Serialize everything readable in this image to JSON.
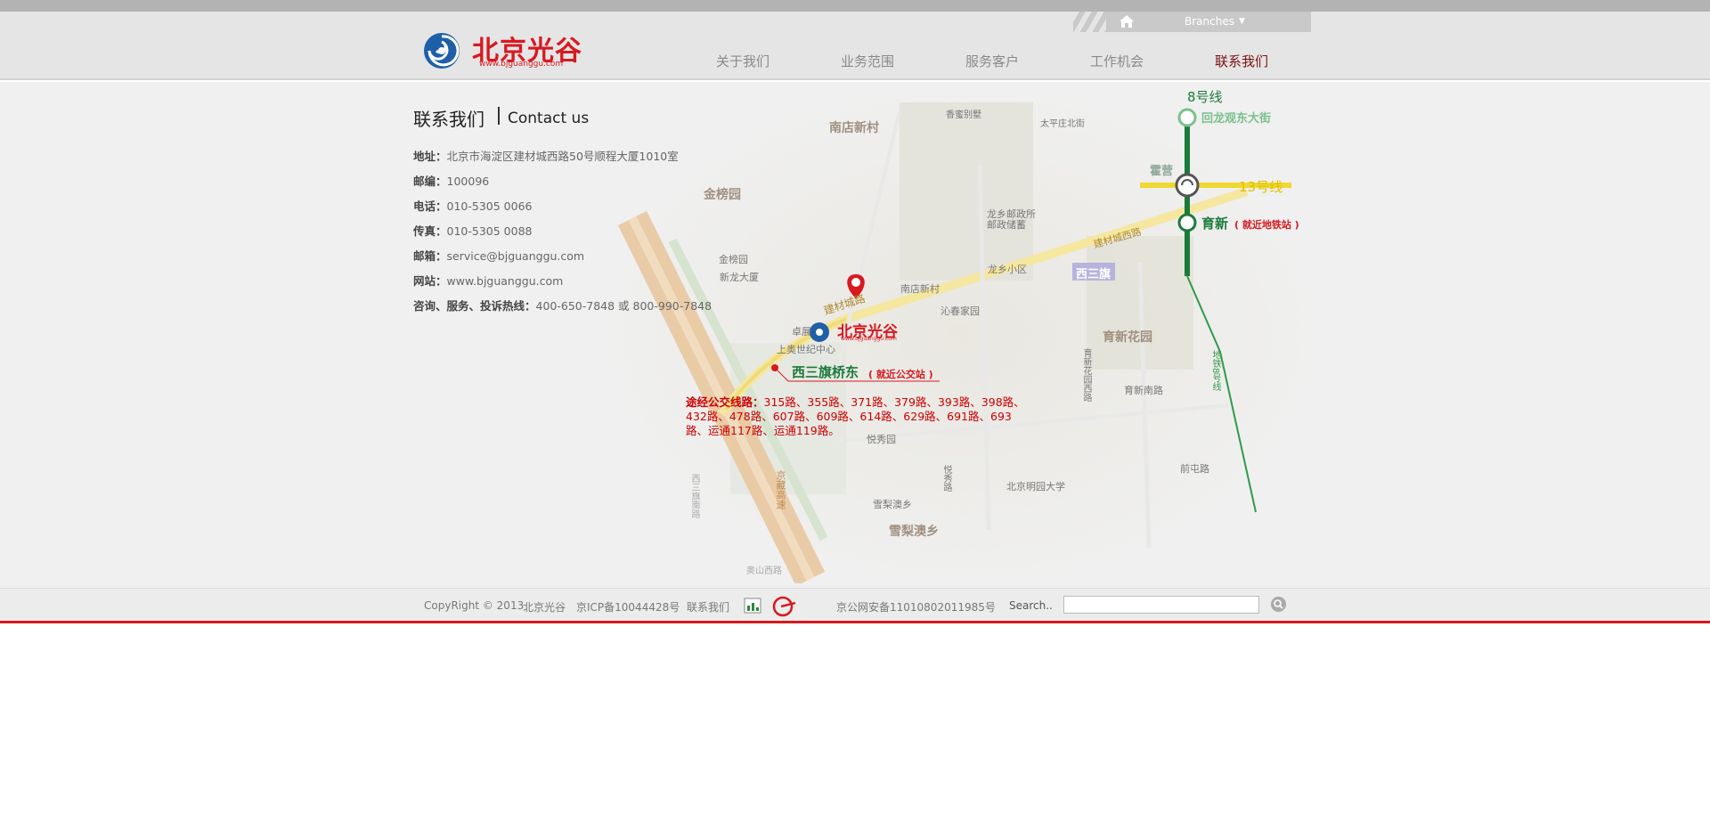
{
  "header": {
    "branches_label": "Branches",
    "logo_name": "北京光谷",
    "logo_url": "www.bjguanggu.com",
    "nav": [
      "关于我们",
      "业务范围",
      "服务客户",
      "工作机会",
      "联系我们"
    ],
    "active_nav": "联系我们"
  },
  "contact": {
    "title_cn": "联系我们",
    "title_en": "Contact us",
    "rows": [
      {
        "label": "地址：",
        "value": "北京市海淀区建材城西路50号顺程大厦1010室"
      },
      {
        "label": "邮编：",
        "value": "100096"
      },
      {
        "label": "电话：",
        "value": "010-5305 0066"
      },
      {
        "label": "传真：",
        "value": "010-5305 0088"
      },
      {
        "label": "邮箱：",
        "value": "service@bjguanggu.com"
      },
      {
        "label": "网站：",
        "value": "www.bjguanggu.com"
      },
      {
        "label": "咨询、服务、投诉热线：",
        "value": "400-650-7848 或 800-990-7848"
      }
    ]
  },
  "map": {
    "line8": "8号线",
    "line13": "13号线",
    "station_huilongguan": "回龙观东大街",
    "station_huoying": "霍营",
    "station_yuxin": "育新",
    "station_yuxin_note": "( 就近地铁站 )",
    "bus_stop": "西三旗桥东",
    "bus_stop_note": "( 就近公交站 )",
    "bus_title": "途经公交线路：",
    "bus_lines": "315路、355路、371路、379路、393路、398路、432路、478路、607路、609路、614路、629路、691路、693路、运通117路、运通119路。",
    "logo_name": "北京光谷",
    "logo_url": "www.bjguanggu.com",
    "labels": {
      "nandian_big": "南店新村",
      "jinbangyuan_big": "金榜园",
      "yuxinhuayuan_big": "育新花园",
      "xueli_big": "雪梨澳乡",
      "xisanqi": "西三旗",
      "xiangbieshu": "香蜜别墅",
      "taiping": "太平庄北街",
      "jinbangyuan": "金榜园",
      "xinlong": "新龙大厦",
      "zhuoyi": "卓展",
      "shangao": "上奥世纪中心",
      "nandian": "南店新村",
      "qinchun": "沁春家园",
      "longxiang": "龙乡小区",
      "youju": "龙乡邮政所",
      "youju2": "邮政储蓄",
      "jiancai_road": "建材城路",
      "jiancai_west": "建材城西路",
      "yuexiu": "悦秀园",
      "yuexiu_road": "悦秀路",
      "xueli": "雪梨澳乡",
      "mingyuan": "北京明园大学",
      "yuxin_nan": "育新南路",
      "yuxin_west": "育新花园西路",
      "qiantun": "前屯路",
      "subway8": "地铁8号线",
      "jingcang": "京藏高速",
      "xisanqi_south": "西三旗南路",
      "guanshan": "奥山西路"
    }
  },
  "footer": {
    "copyright": "CopyRight © 2013",
    "company": "北京光谷",
    "icp": "京ICP备10044428号",
    "contact": "联系我们",
    "police": "京公网安备11010802011985号",
    "search_label": "Search..",
    "search_value": ""
  },
  "colors": {
    "brand_red": "#d71920",
    "line8_green": "#1b7a3a",
    "line13_yellow": "#f0d200"
  }
}
